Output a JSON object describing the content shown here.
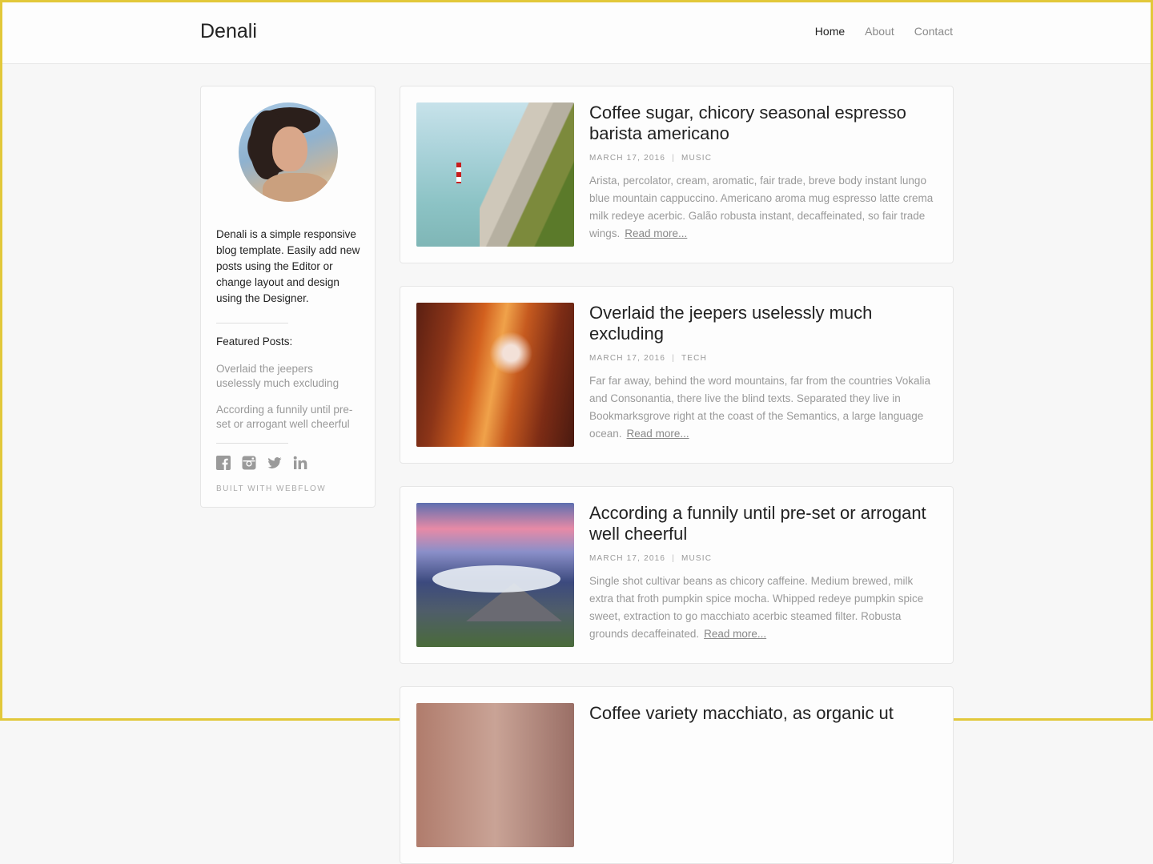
{
  "nav": {
    "brand": "Denali",
    "links": [
      "Home",
      "About",
      "Contact"
    ]
  },
  "sidebar": {
    "bio": "Denali is a simple responsive blog template. Easily add new posts using the Editor or change layout and design using the Designer.",
    "featured_title": "Featured Posts:",
    "featured": [
      "Overlaid the jeepers uselessly much excluding",
      "According a funnily until pre-set or arrogant well cheerful"
    ],
    "social_icons": [
      "facebook-icon",
      "instagram-icon",
      "twitter-icon",
      "linkedin-icon"
    ],
    "built_with": "BUILT WITH WEBFLOW"
  },
  "posts": [
    {
      "title": "Coffee sugar, chicory seasonal espresso barista americano",
      "date": "MARCH 17, 2016",
      "category": "MUSIC",
      "excerpt": "Arista, percolator, cream, aromatic, fair trade, breve body instant lungo blue mountain cappuccino. Americano aroma mug espresso latte crema milk redeye acerbic. Galão robusta instant, decaffeinated, so fair trade wings.",
      "read_more": "Read more..."
    },
    {
      "title": "Overlaid the jeepers uselessly much excluding",
      "date": "MARCH 17, 2016",
      "category": "TECH",
      "excerpt": "Far far away, behind the word mountains, far from the countries Vokalia and Consonantia, there live the blind texts. Separated they live in Bookmarksgrove right at the coast of the Semantics, a large language ocean.",
      "read_more": "Read more..."
    },
    {
      "title": "According a funnily until pre-set or arrogant well cheerful",
      "date": "MARCH 17, 2016",
      "category": "MUSIC",
      "excerpt": "Single shot cultivar beans as chicory caffeine. Medium brewed, milk extra that froth pumpkin spice mocha. Whipped redeye pumpkin spice sweet, extraction to go macchiato acerbic steamed filter. Robusta grounds decaffeinated.",
      "read_more": "Read more..."
    },
    {
      "title": "Coffee variety macchiato, as organic ut"
    }
  ],
  "colors": {
    "frame": "#e2c83a",
    "background": "#f7f7f7",
    "muted_text": "#999999"
  }
}
